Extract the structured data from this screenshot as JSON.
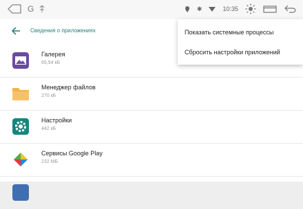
{
  "status_bar": {
    "g_label": "G",
    "time": "10:35",
    "icons": [
      "home-icon",
      "g-icon",
      "usb-icon",
      "location-icon",
      "bluetooth-icon",
      "wifi-icon",
      "brightness-icon",
      "window-icon",
      "back-icon"
    ]
  },
  "app_bar": {
    "title": "Сведения о приложениях"
  },
  "menu": {
    "items": [
      {
        "label": "Показать системные процессы"
      },
      {
        "label": "Сбросить настройки приложений"
      }
    ]
  },
  "apps": [
    {
      "name": "Галерея",
      "size": "65,54 кБ",
      "icon": "gallery-icon",
      "color": "#6a4aa0"
    },
    {
      "name": "Менеджер файлов",
      "size": "270 кБ",
      "icon": "folder-icon",
      "color": "#f4b24a"
    },
    {
      "name": "Настройки",
      "size": "442 кБ",
      "icon": "settings-icon",
      "color": "#16857c"
    },
    {
      "name": "Сервисы Google Play",
      "size": "232 МБ",
      "icon": "google-play-services-icon",
      "color": "#2e7d32"
    }
  ]
}
